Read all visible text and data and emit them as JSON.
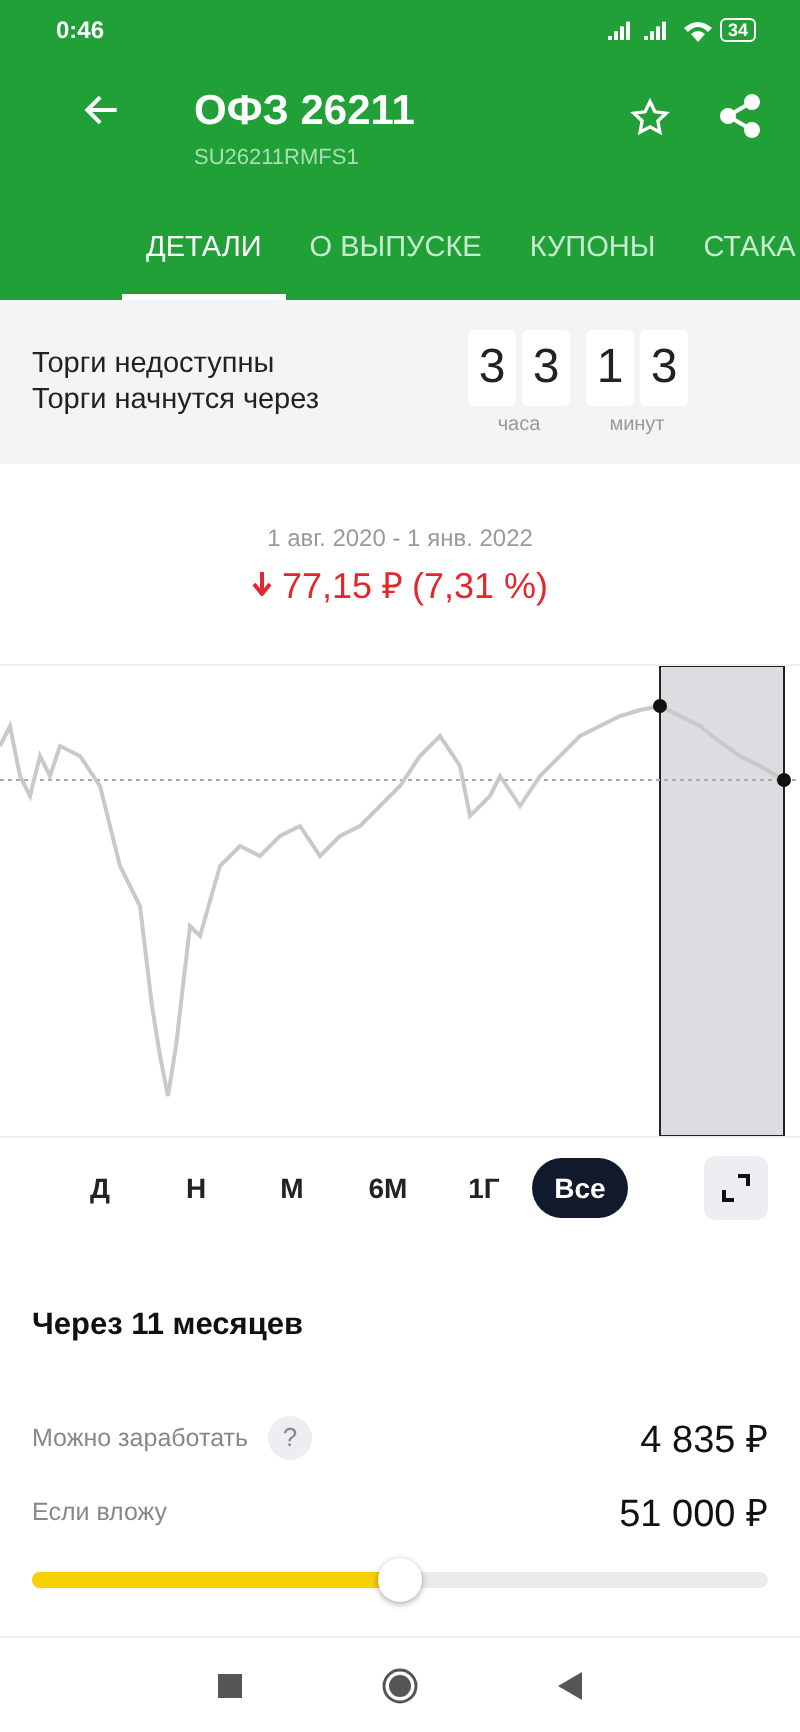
{
  "status_bar": {
    "time": "0:46",
    "battery": "34"
  },
  "header": {
    "title": "ОФЗ 26211",
    "subtitle": "SU26211RMFS1",
    "favorite": false
  },
  "tabs": [
    {
      "label": "ДЕТАЛИ",
      "selected": true
    },
    {
      "label": "О ВЫПУСКЕ",
      "selected": false
    },
    {
      "label": "КУПОНЫ",
      "selected": false
    },
    {
      "label": "СТАКА",
      "selected": false
    }
  ],
  "trading": {
    "lines": [
      "Торги недоступны",
      "Торги начнутся через"
    ],
    "countdown": [
      {
        "digits": [
          "3",
          "3"
        ],
        "unit": "часа"
      },
      {
        "digits": [
          "1",
          "3"
        ],
        "unit": "минут"
      }
    ]
  },
  "summary": {
    "period": "1 авг. 2020 - 1 янв. 2022",
    "change": "77,15 ₽ (7,31 %)",
    "falling": true
  },
  "periods": [
    {
      "label": "Д",
      "selected": false
    },
    {
      "label": "Н",
      "selected": false
    },
    {
      "label": "М",
      "selected": false
    },
    {
      "label": "6М",
      "selected": false
    },
    {
      "label": "1Г",
      "selected": false
    },
    {
      "label": "Все",
      "selected": true
    }
  ],
  "forecast": {
    "title": "Через 11 месяцев",
    "rows": [
      {
        "label": "Можно заработать",
        "value": "4 835 ₽",
        "help": "?"
      },
      {
        "label": "Если вложу",
        "value": "51 000 ₽"
      }
    ],
    "level": 0.5
  }
}
